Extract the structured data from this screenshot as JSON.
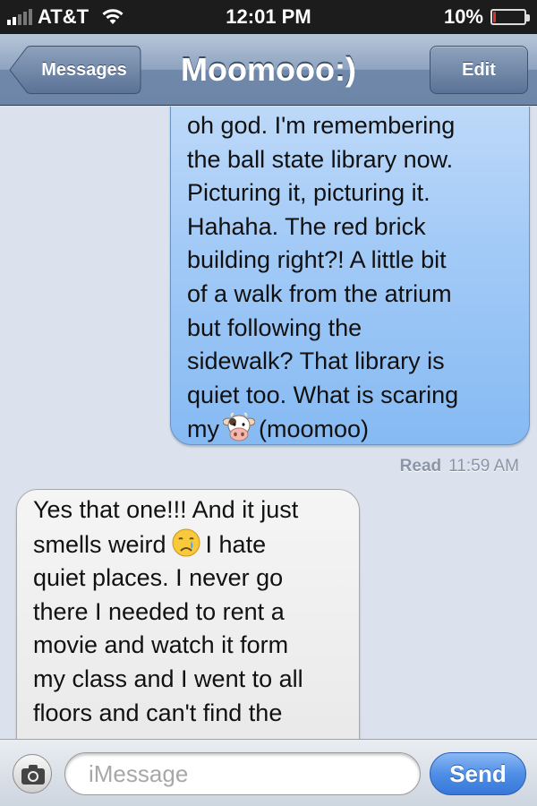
{
  "status_bar": {
    "carrier": "AT&T",
    "time": "12:01 PM",
    "battery_percent": "10%",
    "battery_level": 0.1,
    "signal_bars": 2,
    "signal_total": 5,
    "icons": [
      "signal-icon",
      "wifi-icon",
      "battery-icon"
    ]
  },
  "nav": {
    "back_label": "Messages",
    "title": "Moomooo:)",
    "edit_label": "Edit"
  },
  "messages": [
    {
      "direction": "sent",
      "lines": [
        "oh god. I'm remembering",
        "the ball state library now.",
        "Picturing it, picturing it.",
        "Hahaha. The red brick",
        "building right?! A little bit",
        "of a walk from the atrium",
        "but following the",
        "sidewalk? That library is",
        "quiet too. What is scaring",
        "my"
      ],
      "emoji": "cow-face-emoji",
      "trailing_text": "(moomoo)"
    },
    {
      "direction": "received",
      "lines": [
        "Yes that one!!! And it just",
        "smells weird",
        "quiet places. I never go",
        "there I needed to rent a",
        "movie and watch it form",
        "my class and I went to all",
        "floors and can't find the"
      ],
      "emoji": "crying-face-emoji",
      "emoji_trailing_text": "I hate"
    }
  ],
  "read_receipt": {
    "label": "Read",
    "time": "11:59 AM"
  },
  "input": {
    "placeholder": "iMessage",
    "send_label": "Send",
    "camera_icon": "camera-icon"
  },
  "colors": {
    "sent_bubble": "#a4cbf7",
    "received_bubble": "#ececec",
    "nav_bar": "#7f97b6",
    "send_button": "#4f8fe6",
    "battery_low": "#e0312b"
  }
}
